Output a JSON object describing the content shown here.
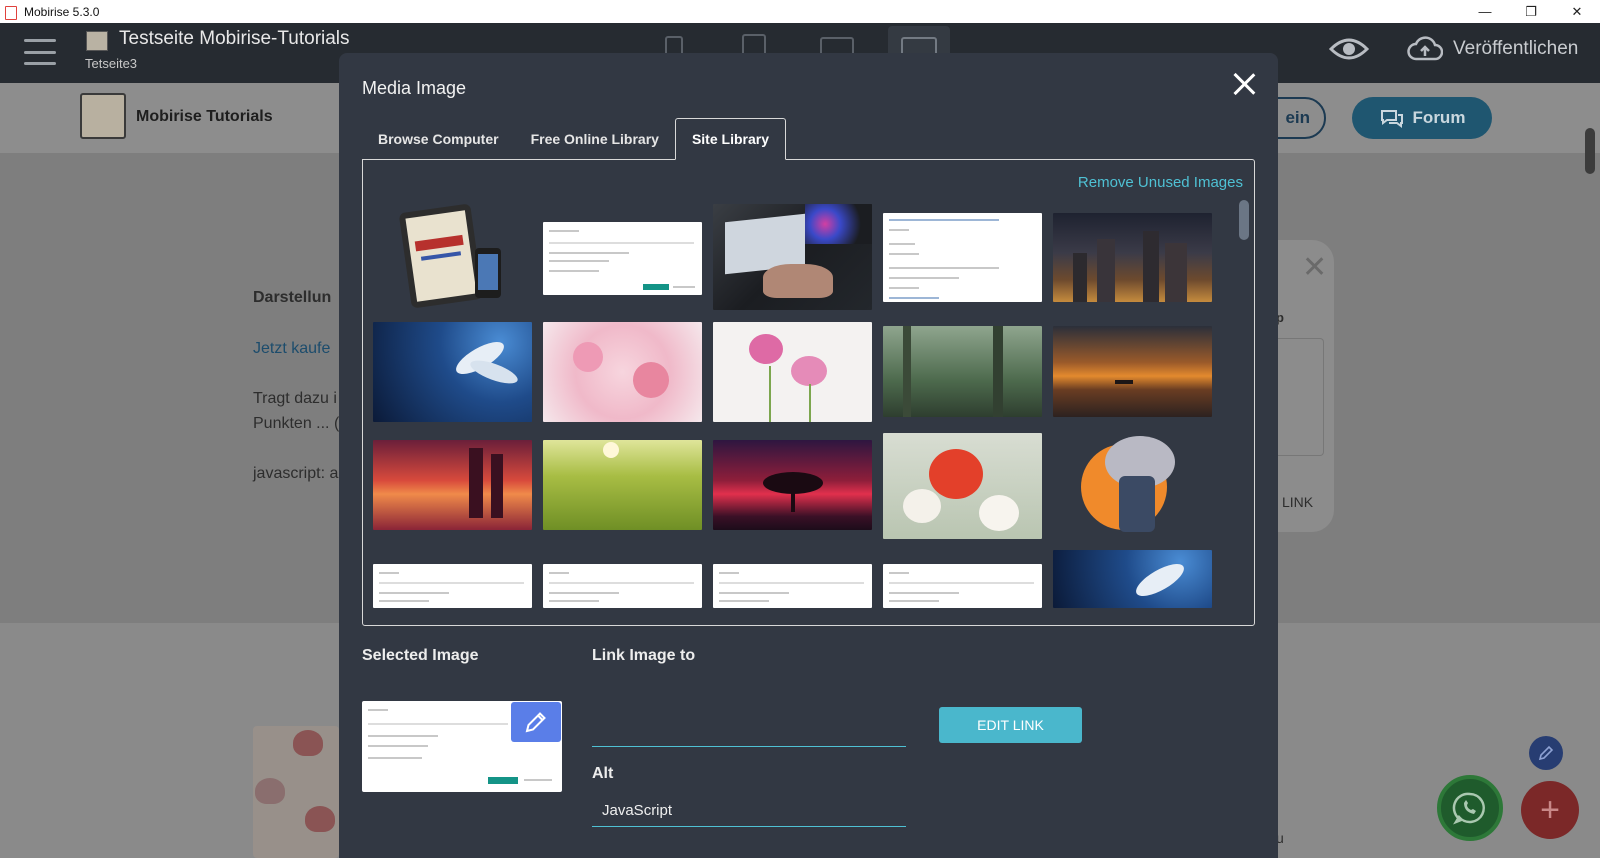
{
  "window": {
    "title": "Mobirise 5.3.0",
    "controls": [
      "—",
      "❐",
      "✕"
    ]
  },
  "appbar": {
    "project_title": "Testseite Mobirise-Tutorials",
    "project_subtitle": "Tetseite3",
    "publish_label": "Veröffentlichen"
  },
  "site": {
    "brand": "Mobirise Tutorials",
    "nav_button_partial": "ein",
    "forum_button": "Forum",
    "text_heading": "Darstellun",
    "text_link": "Jetzt kaufe",
    "text_line1": "Tragt dazu i",
    "text_line2": "Punkten ... (",
    "text_line3": "javascript: a",
    "card_label": "p",
    "card_link": "LINK",
    "card_partial_u": "u"
  },
  "modal": {
    "title": "Media Image",
    "tabs": [
      {
        "label": "Browse Computer",
        "active": false
      },
      {
        "label": "Free Online Library",
        "active": false
      },
      {
        "label": "Site Library",
        "active": true
      }
    ],
    "remove_unused": "Remove Unused Images",
    "thumbnails": [
      "tutorials-tablet-cover",
      "link-dialog-screenshot",
      "laptop-typing",
      "form-text-screenshot",
      "city-night-skyline",
      "white-lily-blue",
      "pink-cherry-blossom",
      "pink-cosmos-flowers",
      "misty-forest",
      "sunset-lake-boat",
      "red-sunset-trees",
      "green-wheat-field",
      "tree-sunset-red-sky",
      "red-white-poppies",
      "elephant-mascot",
      "link-dialog-screenshot-2",
      "link-dialog-screenshot-3",
      "link-dialog-screenshot-4",
      "link-dialog-screenshot-5",
      "white-lily-blue-2"
    ],
    "selected_image_label": "Selected Image",
    "link_image_label": "Link Image to",
    "link_value": "",
    "edit_link_button": "EDIT LINK",
    "alt_label": "Alt",
    "alt_value": "JavaScript"
  },
  "colors": {
    "accent": "#4fc1d4",
    "modal_bg": "#323843",
    "appbar_bg": "#262b31",
    "edit_button": "#4ab7cc",
    "pencil_badge": "#5a7ee8"
  }
}
